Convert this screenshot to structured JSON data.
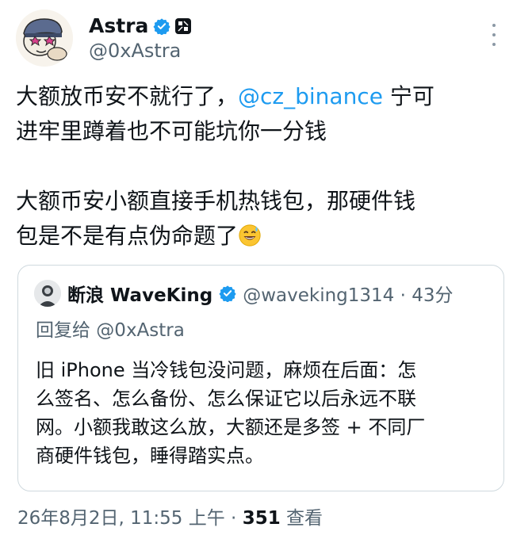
{
  "author": {
    "name": "Astra",
    "handle": "@0xAstra"
  },
  "tweet": {
    "line1_before": "大额放币安不就行了，",
    "mention": "@cz_binance",
    "line1_after": " 宁可",
    "line2": "进牢里蹲着也不可能坑你一分钱",
    "para2_line1": "大额币安小额直接手机热钱包，那硬件钱",
    "para2_line2": "包是不是有点伪命题了",
    "emoji": "sweat-smile-emoji"
  },
  "quote": {
    "name": "断浪 WaveKing",
    "handle_time": "@waveking1314 · 43分",
    "reply_to": "回复给 @0xAstra",
    "body_lines": [
      "旧 iPhone 当冷钱包没问题，麻烦在后面：怎",
      "么签名、怎么备份、怎么保证它以后永远不联",
      "网。小额我敢这么放，大额还是多签 + 不同厂",
      "商硬件钱包，睡得踏实点。"
    ]
  },
  "meta": {
    "timestamp": "26年8月2日, 11:55 上午 · ",
    "views_count": "351",
    "views_label": " 查看"
  },
  "colors": {
    "link": "#1d9bf0",
    "secondary_text": "#536471",
    "border": "#cfd9de"
  }
}
